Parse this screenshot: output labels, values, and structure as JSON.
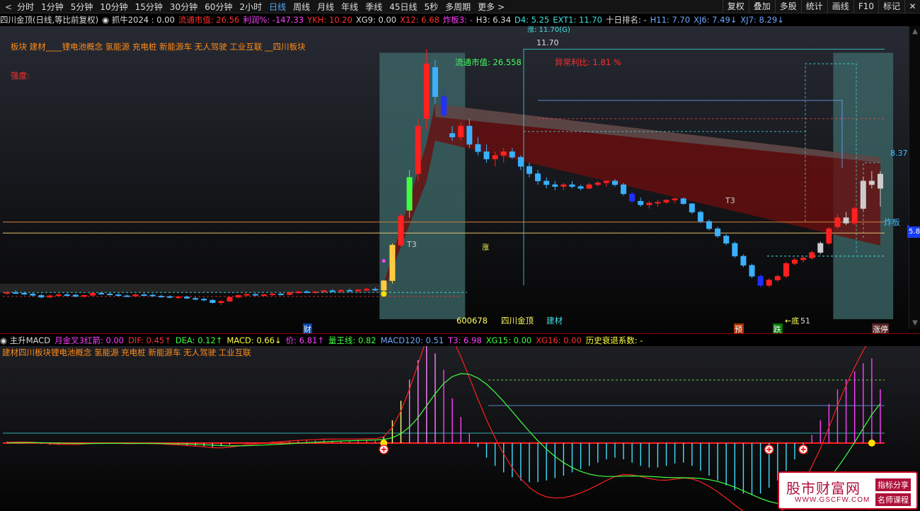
{
  "toolbar": {
    "periods": [
      "分时",
      "1分钟",
      "5分钟",
      "10分钟",
      "15分钟",
      "30分钟",
      "60分钟",
      "2小时",
      "日线",
      "周线",
      "月线",
      "年线",
      "季线",
      "45日线",
      "5秒",
      "多周期",
      "更多"
    ],
    "active_period": "日线",
    "right_buttons": [
      "复权",
      "叠加",
      "多股",
      "统计",
      "画线",
      "F10",
      "标记",
      "✕"
    ]
  },
  "indicator_line": [
    {
      "text": "四川金顶(日线,等比前复权)",
      "color": "#dddddd"
    },
    {
      "text": "◉ 抓牛2024 : 0.00",
      "color": "#dddddd"
    },
    {
      "text": "流通市值: 26.56",
      "color": "#ff3030"
    },
    {
      "text": "利润%: -147.33",
      "color": "#ff40ff"
    },
    {
      "text": "YKH: 10.20",
      "color": "#ff3030"
    },
    {
      "text": "XG9: 0.00",
      "color": "#dddddd"
    },
    {
      "text": "X12: 6.68",
      "color": "#ff3030"
    },
    {
      "text": "炸板3: -",
      "color": "#ff40ff"
    },
    {
      "text": "H3: 6.34",
      "color": "#dddddd"
    },
    {
      "text": "D4: 5.25",
      "color": "#40e0e0"
    },
    {
      "text": "EXT1: 11.70",
      "color": "#40e0e0"
    },
    {
      "text": "十日排名: -",
      "color": "#dddddd"
    },
    {
      "text": "H11: 7.70",
      "color": "#6fa8ff"
    },
    {
      "text": "XJ6: 7.49↓",
      "color": "#6fa8ff"
    },
    {
      "text": "XJ7: 8.29↓",
      "color": "#6fa8ff"
    }
  ],
  "main_labels": {
    "sectors": "板块 建材____锂电池概念 氢能源 充电桩 新能源车 无人驾驶 工业互联 __四川板块",
    "rating": "强度:",
    "float_cap": "流通市值:  26.558",
    "profit": "异常利比: 1.81 %",
    "high_mark": "11.70",
    "top_note": "涨: 11.70(G)",
    "price_right": "8.37",
    "zhaban": "炸板",
    "edge_price": "5.8",
    "code": "600678",
    "name": "四川金顶",
    "sector_tag": "建材",
    "t3_a": "T3",
    "t3_b": "T3",
    "cai": "财",
    "yu": "预",
    "die": "跌",
    "di": "←底",
    "di_val": "51",
    "zhangting": "涨停",
    "zhi": "涨"
  },
  "sub_header": [
    {
      "text": "◉ 主升MACD",
      "color": "#dddddd"
    },
    {
      "text": "月金叉3红箭: 0.00",
      "color": "#ff40ff"
    },
    {
      "text": "DIF: 0.45↑",
      "color": "#ff3030"
    },
    {
      "text": "DEA: 0.12↑",
      "color": "#40ff40"
    },
    {
      "text": "MACD: 0.66↓",
      "color": "#ffff40"
    },
    {
      "text": "价: 6.81↑",
      "color": "#ff40ff"
    },
    {
      "text": "量王线: 0.82",
      "color": "#40ff40"
    },
    {
      "text": "MACD120: 0.51",
      "color": "#6fa8ff"
    },
    {
      "text": "T3: 6.98",
      "color": "#ff40ff"
    },
    {
      "text": "XG15: 0.00",
      "color": "#40ff40"
    },
    {
      "text": "XG16: 0.00",
      "color": "#ff3030"
    },
    {
      "text": "历史衰退系数: -",
      "color": "#ffff40"
    }
  ],
  "sub_labels": {
    "sectors": "建材四川板块锂电池概念 氢能源 充电桩 新能源车 无人驾驶 工业互联"
  },
  "watermark": {
    "title": "股市财富网",
    "url": "WWW.GSCFW.COM",
    "badge1": "指标分享",
    "badge2": "名师课程"
  },
  "colors": {
    "up": "#ff2020",
    "down": "#3ab0ff",
    "accent": "#58a6ff",
    "bg": "#000000"
  },
  "chart_data": {
    "type": "candlestick",
    "x_unit": "trading day index",
    "ohlc": [
      [
        5.05,
        5.1,
        5.0,
        5.06
      ],
      [
        5.06,
        5.12,
        5.02,
        5.04
      ],
      [
        5.04,
        5.08,
        4.98,
        5.02
      ],
      [
        5.02,
        5.05,
        4.95,
        4.98
      ],
      [
        4.98,
        5.02,
        4.9,
        4.93
      ],
      [
        4.93,
        5.0,
        4.9,
        4.97
      ],
      [
        4.97,
        5.03,
        4.95,
        5.0
      ],
      [
        5.0,
        5.04,
        4.96,
        4.99
      ],
      [
        4.99,
        5.02,
        4.93,
        4.95
      ],
      [
        4.95,
        5.0,
        4.92,
        4.98
      ],
      [
        4.98,
        5.06,
        4.96,
        5.04
      ],
      [
        5.04,
        5.08,
        5.0,
        5.02
      ],
      [
        5.02,
        5.05,
        4.98,
        5.0
      ],
      [
        5.0,
        5.03,
        4.95,
        4.97
      ],
      [
        4.97,
        5.0,
        4.94,
        4.96
      ],
      [
        4.96,
        5.02,
        4.94,
        5.0
      ],
      [
        5.0,
        5.04,
        4.97,
        4.99
      ],
      [
        4.99,
        5.02,
        4.94,
        4.96
      ],
      [
        4.96,
        5.0,
        4.92,
        4.95
      ],
      [
        4.95,
        4.98,
        4.9,
        4.92
      ],
      [
        4.92,
        4.96,
        4.88,
        4.94
      ],
      [
        4.94,
        4.97,
        4.88,
        4.9
      ],
      [
        4.9,
        4.94,
        4.85,
        4.88
      ],
      [
        4.88,
        4.92,
        4.82,
        4.85
      ],
      [
        4.85,
        4.88,
        4.76,
        4.78
      ],
      [
        4.78,
        4.84,
        4.72,
        4.82
      ],
      [
        4.82,
        4.95,
        4.8,
        4.93
      ],
      [
        4.93,
        5.0,
        4.9,
        4.98
      ],
      [
        4.98,
        5.03,
        4.95,
        5.01
      ],
      [
        5.01,
        5.04,
        4.96,
        4.98
      ],
      [
        4.98,
        5.02,
        4.95,
        5.0
      ],
      [
        5.0,
        5.05,
        4.97,
        5.02
      ],
      [
        5.02,
        5.06,
        4.98,
        5.0
      ],
      [
        5.0,
        5.08,
        4.98,
        5.06
      ],
      [
        5.06,
        5.1,
        5.02,
        5.08
      ],
      [
        5.08,
        5.12,
        5.04,
        5.06
      ],
      [
        5.06,
        5.1,
        5.02,
        5.08
      ],
      [
        5.08,
        5.13,
        5.05,
        5.11
      ],
      [
        5.11,
        5.15,
        5.06,
        5.09
      ],
      [
        5.09,
        5.14,
        5.05,
        5.12
      ],
      [
        5.12,
        5.16,
        5.07,
        5.1
      ],
      [
        5.1,
        5.15,
        5.06,
        5.13
      ],
      [
        5.13,
        5.18,
        5.09,
        5.15
      ],
      [
        5.15,
        5.2,
        5.1,
        5.12
      ],
      [
        5.12,
        5.4,
        5.1,
        5.38
      ],
      [
        5.38,
        6.4,
        5.3,
        6.35
      ],
      [
        6.35,
        7.2,
        6.3,
        7.15
      ],
      [
        7.3,
        8.4,
        7.1,
        8.2
      ],
      [
        8.3,
        9.8,
        8.1,
        9.6
      ],
      [
        9.8,
        11.7,
        9.5,
        11.3
      ],
      [
        11.2,
        11.4,
        10.2,
        10.4
      ],
      [
        10.4,
        10.6,
        9.8,
        9.9
      ],
      [
        9.4,
        9.6,
        9.2,
        9.3
      ],
      [
        9.3,
        9.7,
        9.2,
        9.6
      ],
      [
        9.6,
        9.8,
        9.0,
        9.1
      ],
      [
        9.1,
        9.3,
        8.8,
        8.9
      ],
      [
        8.9,
        9.1,
        8.6,
        8.7
      ],
      [
        8.7,
        8.9,
        8.5,
        8.8
      ],
      [
        8.8,
        9.0,
        8.6,
        8.9
      ],
      [
        8.9,
        9.0,
        8.7,
        8.75
      ],
      [
        8.75,
        8.8,
        8.4,
        8.5
      ],
      [
        8.5,
        8.6,
        8.2,
        8.3
      ],
      [
        8.3,
        8.4,
        8.0,
        8.1
      ],
      [
        8.1,
        8.2,
        7.9,
        8.0
      ],
      [
        8.0,
        8.1,
        7.85,
        7.95
      ],
      [
        7.95,
        8.05,
        7.85,
        8.0
      ],
      [
        8.0,
        8.1,
        7.9,
        7.95
      ],
      [
        7.95,
        8.0,
        7.85,
        7.9
      ],
      [
        7.9,
        8.05,
        7.88,
        8.0
      ],
      [
        8.0,
        8.1,
        7.95,
        8.05
      ],
      [
        8.05,
        8.12,
        7.95,
        8.1
      ],
      [
        8.1,
        8.15,
        7.95,
        8.0
      ],
      [
        8.0,
        8.05,
        7.7,
        7.75
      ],
      [
        7.75,
        7.8,
        7.5,
        7.55
      ],
      [
        7.55,
        7.65,
        7.4,
        7.45
      ],
      [
        7.45,
        7.55,
        7.35,
        7.5
      ],
      [
        7.5,
        7.58,
        7.4,
        7.52
      ],
      [
        7.52,
        7.6,
        7.48,
        7.58
      ],
      [
        7.58,
        7.65,
        7.5,
        7.62
      ],
      [
        7.62,
        7.65,
        7.45,
        7.48
      ],
      [
        7.48,
        7.5,
        7.2,
        7.25
      ],
      [
        7.25,
        7.3,
        6.95,
        7.0
      ],
      [
        7.0,
        7.05,
        6.75,
        6.8
      ],
      [
        6.8,
        6.85,
        6.55,
        6.6
      ],
      [
        6.6,
        6.65,
        6.35,
        6.4
      ],
      [
        6.4,
        6.45,
        6.0,
        6.05
      ],
      [
        6.05,
        6.1,
        5.75,
        5.8
      ],
      [
        5.8,
        5.85,
        5.45,
        5.5
      ],
      [
        5.5,
        5.55,
        5.2,
        5.25
      ],
      [
        5.25,
        5.45,
        5.2,
        5.4
      ],
      [
        5.4,
        5.55,
        5.35,
        5.5
      ],
      [
        5.5,
        5.9,
        5.45,
        5.85
      ],
      [
        5.85,
        6.0,
        5.8,
        5.95
      ],
      [
        5.95,
        6.05,
        5.88,
        6.0
      ],
      [
        6.0,
        6.2,
        5.95,
        6.15
      ],
      [
        6.15,
        6.45,
        6.1,
        6.4
      ],
      [
        6.4,
        6.85,
        6.35,
        6.8
      ],
      [
        6.85,
        7.2,
        6.8,
        7.1
      ],
      [
        7.1,
        7.25,
        6.9,
        6.95
      ],
      [
        6.95,
        7.4,
        6.9,
        7.35
      ],
      [
        7.35,
        8.2,
        7.3,
        8.1
      ],
      [
        8.1,
        8.37,
        7.9,
        8.0
      ],
      [
        7.9,
        8.37,
        7.4,
        8.29
      ]
    ],
    "y_range": [
      4.6,
      11.9
    ],
    "ref_lines": [
      6.98,
      6.68,
      8.29
    ],
    "macd_hist": [
      0.02,
      0.01,
      0.01,
      0.0,
      -0.01,
      -0.02,
      -0.02,
      -0.01,
      -0.01,
      0.0,
      0.01,
      0.01,
      0.0,
      -0.01,
      -0.01,
      0.0,
      0.0,
      -0.01,
      -0.01,
      -0.02,
      -0.02,
      -0.03,
      -0.03,
      -0.04,
      -0.05,
      -0.04,
      -0.02,
      0.0,
      0.01,
      0.01,
      0.01,
      0.02,
      0.02,
      0.03,
      0.03,
      0.03,
      0.03,
      0.04,
      0.03,
      0.03,
      0.03,
      0.03,
      0.04,
      0.03,
      0.08,
      0.28,
      0.52,
      0.78,
      1.02,
      1.22,
      1.1,
      0.9,
      0.55,
      0.32,
      0.12,
      -0.05,
      -0.18,
      -0.28,
      -0.36,
      -0.42,
      -0.46,
      -0.48,
      -0.48,
      -0.46,
      -0.43,
      -0.4,
      -0.36,
      -0.32,
      -0.28,
      -0.24,
      -0.2,
      -0.18,
      -0.2,
      -0.24,
      -0.28,
      -0.3,
      -0.3,
      -0.28,
      -0.25,
      -0.24,
      -0.28,
      -0.34,
      -0.4,
      -0.46,
      -0.52,
      -0.58,
      -0.62,
      -0.64,
      -0.62,
      -0.55,
      -0.46,
      -0.34,
      -0.2,
      -0.06,
      0.1,
      0.28,
      0.48,
      0.66,
      0.78,
      0.88,
      0.98,
      1.04,
      0.66
    ],
    "dif_end": 0.45,
    "dea_end": 0.12
  }
}
